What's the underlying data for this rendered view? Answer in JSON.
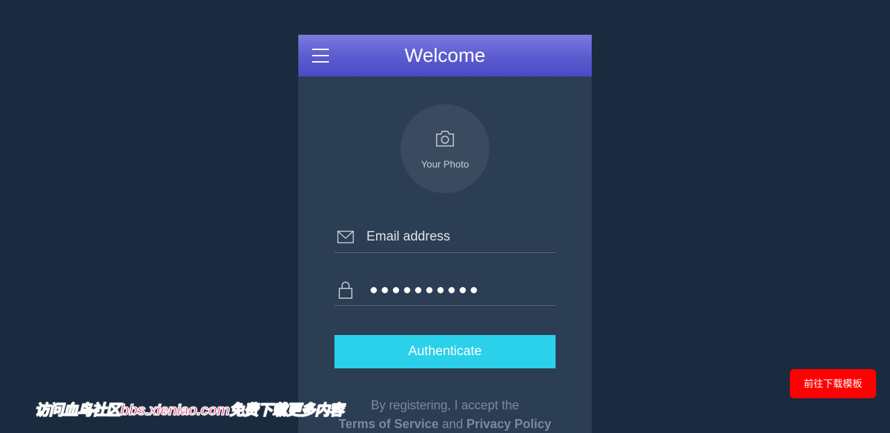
{
  "header": {
    "title": "Welcome"
  },
  "avatar": {
    "label": "Your Photo"
  },
  "form": {
    "email": {
      "placeholder": "Email address",
      "value": ""
    },
    "password": {
      "value": "password12"
    },
    "submit_label": "Authenticate"
  },
  "terms": {
    "prefix": "By registering, I accept the",
    "tos": "Terms of Service",
    "connector": "and",
    "privacy": "Privacy Policy"
  },
  "download_button": "前往下载模板",
  "watermark": "访问血鸟社区bbs.xieniao.com免费下载更多内容"
}
